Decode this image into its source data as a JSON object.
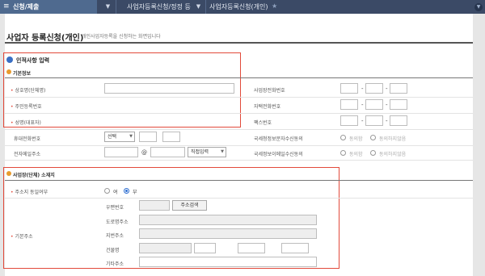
{
  "topbar": {
    "home_label": "신청/제출",
    "crumb1": "사업자등록신청/정정 등",
    "crumb2": "사업자등록신청(개인)"
  },
  "page": {
    "title": "사업자 등록신청(개인)",
    "description": "개인사업자등록을 신청하는 화면입니다"
  },
  "section1": {
    "title": "인적사항 입력",
    "subsection": "기본정보",
    "left_fields": [
      {
        "label": "상호명(단체명)",
        "required": true
      },
      {
        "label": "주민등록번호",
        "required": true
      },
      {
        "label": "성명(대표자)",
        "required": true
      },
      {
        "label": "휴대전화번호",
        "required": false
      },
      {
        "label": "전자메일주소",
        "required": false
      }
    ],
    "right_fields": [
      {
        "label": "사업장전화번호"
      },
      {
        "label": "자택전화번호"
      },
      {
        "label": "팩스번호"
      },
      {
        "label": "국세청정보문자수신동의"
      },
      {
        "label": "국세정보이메일수신동의"
      }
    ],
    "phone_carrier": "선택",
    "email_at": "@",
    "email_domain": "직접입력",
    "consent_yes": "동의함",
    "consent_no": "동의하지않음",
    "email_consent_yes": "동의함",
    "email_consent_no": "동의하지않음"
  },
  "section2": {
    "title": "사업장(단체) 소재지",
    "same_as_address_label": "주소지 동일여부",
    "radio_yes": "여",
    "radio_no": "부",
    "radio_selected": "부",
    "base_address_label": "기본주소",
    "zip_label": "우편번호",
    "zip_search_button": "주소검색",
    "road_address_label": "도로명주소",
    "lot_address_label": "지번주소",
    "building_label": "건물명",
    "other_address_label": "기타주소"
  },
  "colors": {
    "topbar": "#3b4a66",
    "highlight_box": "#e24a3b",
    "section_bullet": "#3a6fc4",
    "sub_bullet": "#e89b2e"
  }
}
